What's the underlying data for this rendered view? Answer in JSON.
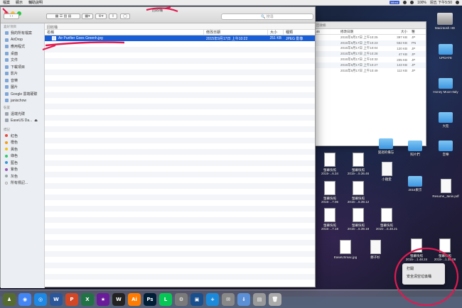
{
  "menubar": {
    "items": [
      "檔案",
      "顯示",
      "輔助說明"
    ],
    "battery": "100%",
    "time": "週五 下午5:50",
    "tag": "Wired"
  },
  "finder": {
    "title": "回收桶",
    "search_placeholder": "搜尋",
    "path_label": "回收桶",
    "columns": {
      "name": "名稱",
      "date": "修改日期",
      "size": "大小",
      "kind": "種類"
    },
    "files": [
      {
        "name": "Air Purifier Goes Greenh.jpg",
        "date": "2015年9月17日 上午10:22",
        "size": "251 KB",
        "kind": "JPEG 影像"
      }
    ],
    "sidebar": {
      "favorites_header": "喜好項目",
      "favorites": [
        "我的所有檔案",
        "AirDrop",
        "應用程式",
        "桌面",
        "文件",
        "下載項目",
        "影片",
        "音樂",
        "圖片",
        "Google 雲端硬碟",
        "janischow"
      ],
      "devices_header": "裝置",
      "devices": [
        "遠端光碟",
        "EaseUS Da..."
      ],
      "tags_header": "標記",
      "tags": [
        {
          "label": "紅色",
          "color": "#e74c3c"
        },
        {
          "label": "橙色",
          "color": "#f39c12"
        },
        {
          "label": "黃色",
          "color": "#f1c40f"
        },
        {
          "label": "綠色",
          "color": "#2ecc71"
        },
        {
          "label": "藍色",
          "color": "#3498db"
        },
        {
          "label": "紫色",
          "color": "#9b59b6"
        },
        {
          "label": "灰色",
          "color": "#95a5a6"
        }
      ],
      "all_tags": "所有標記..."
    }
  },
  "back_window": {
    "title": "回收桶",
    "columns": {
      "date": "修改日期",
      "size": "大小",
      "kind": "種"
    },
    "partial": "3.46",
    "rows": [
      {
        "date": "2015年9月17日 上午10:25",
        "size": "397 KB",
        "kind": "JP"
      },
      {
        "date": "2015年9月17日 上午10:23",
        "size": "562 KB",
        "kind": "PN"
      },
      {
        "date": "2015年9月17日 上午10:04",
        "size": "120 KB",
        "kind": "JP"
      },
      {
        "date": "2015年9月17日 上午10:28",
        "size": "47 KB",
        "kind": "JP"
      },
      {
        "date": "2015年9月17日 上午10:32",
        "size": "205 KB",
        "kind": "JP"
      },
      {
        "date": "2015年9月17日 上午10:27",
        "size": "143 KB",
        "kind": "JP"
      },
      {
        "date": "2015年9月17日 上午10:49",
        "size": "112 KB",
        "kind": "JP"
      }
    ]
  },
  "desktop": {
    "right_icons": [
      "Macintosh HD",
      "UPDATE",
      "Honey Moon-Italy",
      "大陸",
      "音樂",
      "Resume_Janis.pdf"
    ],
    "mid_icons": [
      "當週的備忘",
      "照片們",
      "2015東京"
    ],
    "shots": [
      "螢幕快照 2015-...6.34",
      "螢幕快照 2015-...5.36.46",
      "小雞愛",
      "螢幕快照 2015-...7.06",
      "螢幕快照 2015-...5.39.12",
      "螢幕快照 2015-...7.18",
      "螢幕快照 2015-...5.39.19",
      "螢幕快照 2015-...5.48.21",
      "EaseUSmac.jpg",
      "鄭子杉",
      "螢幕快照 2015-...1.48.24",
      "螢幕快照 2015-...1.35.08"
    ]
  },
  "context_menu": {
    "items": [
      "打開",
      "安全清空垃圾桶"
    ]
  },
  "dock": {
    "icons": [
      "Game",
      "Chrome",
      "Safari",
      "Word",
      "PowerPoint",
      "Excel",
      "iMovie",
      "War of Mine",
      "Illustrator",
      "Photoshop",
      "LINE",
      "Instruments",
      "VirtualBox",
      "Install",
      "Mail",
      "Downloads",
      "Docs",
      "Trash"
    ]
  }
}
